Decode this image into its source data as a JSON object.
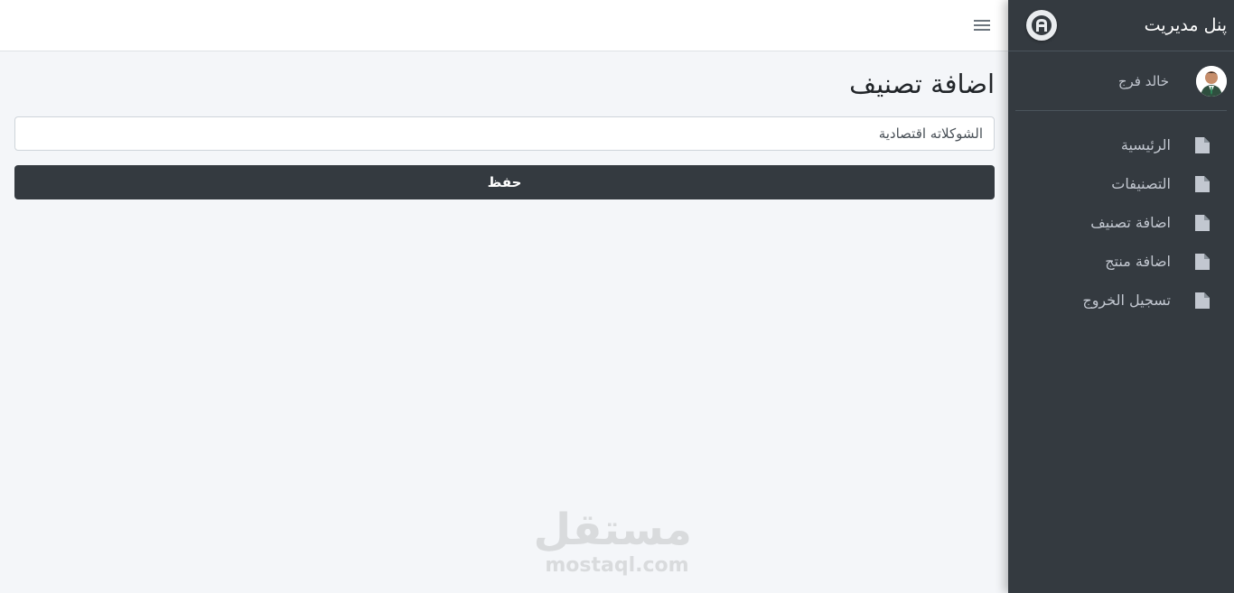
{
  "sidebar": {
    "brand": "پنل مدیریت",
    "user_name": "خالد فرج",
    "items": [
      {
        "label": "الرئيسية",
        "icon": "file-icon"
      },
      {
        "label": "التصنيفات",
        "icon": "file-icon"
      },
      {
        "label": "اضافة تصنيف",
        "icon": "file-icon"
      },
      {
        "label": "اضافة منتج",
        "icon": "file-icon"
      },
      {
        "label": "تسجيل الخروج",
        "icon": "file-icon"
      }
    ]
  },
  "topbar": {
    "menu_icon": "hamburger-icon"
  },
  "main": {
    "title": "اضافة تصنيف",
    "category_value": "الشوكلاته اقتصادية",
    "save_label": "حفظ"
  },
  "watermark": {
    "arabic": "مستقل",
    "latin": "mostaql.com"
  },
  "colors": {
    "sidebar_bg": "#343a40",
    "button_bg": "#343a40",
    "content_bg": "#f4f6f9"
  }
}
